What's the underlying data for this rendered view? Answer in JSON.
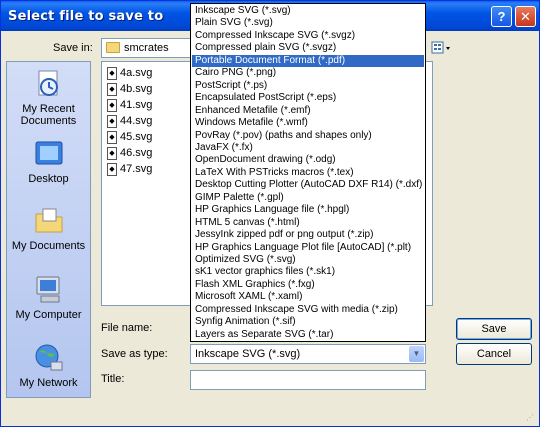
{
  "window": {
    "title": "Select file to save to",
    "help_label": "?",
    "close_label": "✕"
  },
  "save_in": {
    "label": "Save in:",
    "value": "smcrates"
  },
  "places": [
    {
      "label": "My Recent Documents",
      "icon": "recent-documents-icon"
    },
    {
      "label": "Desktop",
      "icon": "desktop-icon"
    },
    {
      "label": "My Documents",
      "icon": "my-documents-icon"
    },
    {
      "label": "My Computer",
      "icon": "my-computer-icon"
    },
    {
      "label": "My Network",
      "icon": "my-network-icon"
    }
  ],
  "files": [
    "4a.svg",
    "4b.svg",
    "41.svg",
    "44.svg",
    "45.svg",
    "46.svg",
    "47.svg"
  ],
  "form": {
    "file_name_label": "File name:",
    "save_as_type_label": "Save as type:",
    "save_as_type_value": "Inkscape SVG (*.svg)",
    "title_label": "Title:"
  },
  "buttons": {
    "save": "Save",
    "cancel": "Cancel"
  },
  "type_options": [
    "Inkscape SVG (*.svg)",
    "Plain SVG (*.svg)",
    "Compressed Inkscape SVG (*.svgz)",
    "Compressed plain SVG (*.svgz)",
    "Portable Document Format (*.pdf)",
    "Cairo PNG (*.png)",
    "PostScript (*.ps)",
    "Encapsulated PostScript (*.eps)",
    "Enhanced Metafile (*.emf)",
    "Windows Metafile (*.wmf)",
    "PovRay (*.pov) (paths and shapes only)",
    "JavaFX (*.fx)",
    "OpenDocument drawing (*.odg)",
    "LaTeX With PSTricks macros (*.tex)",
    "Desktop Cutting Plotter (AutoCAD DXF R14) (*.dxf)",
    "GIMP Palette (*.gpl)",
    "HP Graphics Language file (*.hpgl)",
    "HTML 5 canvas (*.html)",
    "JessyInk zipped pdf or png output (*.zip)",
    "HP Graphics Language Plot file [AutoCAD] (*.plt)",
    "Optimized SVG (*.svg)",
    "sK1 vector graphics files (*.sk1)",
    "Flash XML Graphics (*.fxg)",
    "Microsoft XAML (*.xaml)",
    "Compressed Inkscape SVG with media (*.zip)",
    "Synfig Animation (*.sif)",
    "Layers as Separate SVG (*.tar)"
  ],
  "selected_option_index": 4,
  "colors": {
    "titlebar": "#0055e5",
    "selection": "#316ac5",
    "dialog_bg": "#ece9d8"
  }
}
